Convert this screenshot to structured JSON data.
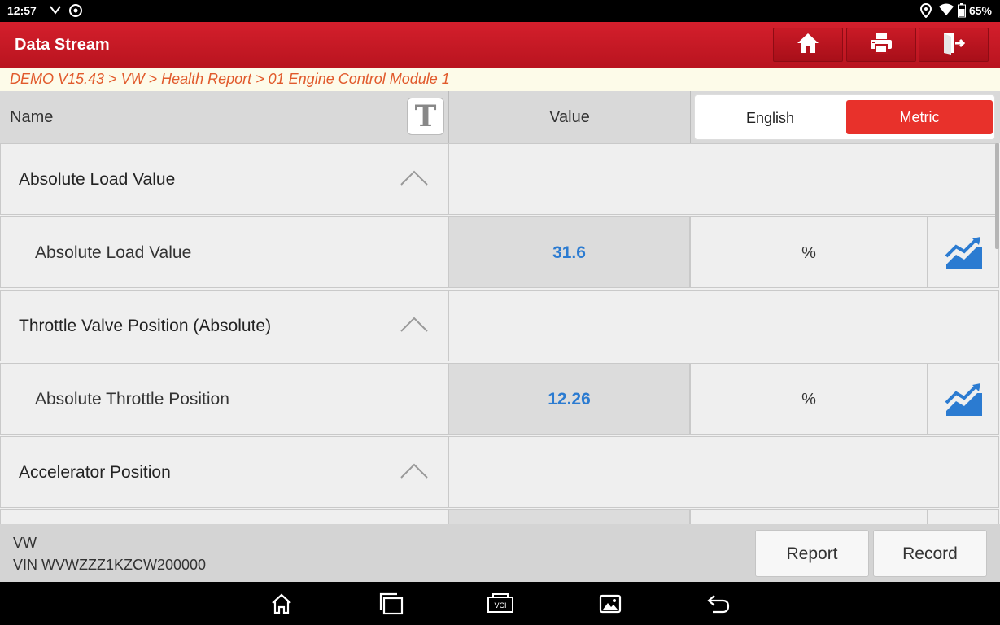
{
  "status_bar": {
    "time": "12:57",
    "battery": "65%"
  },
  "header": {
    "title": "Data Stream",
    "icons": [
      "home-icon",
      "print-icon",
      "exit-icon"
    ]
  },
  "breadcrumb": "DEMO V15.43 > VW > Health Report > 01 Engine Control Module 1",
  "table_header": {
    "name": "Name",
    "font_button": "T",
    "value": "Value",
    "unit_options": [
      "English",
      "Metric"
    ],
    "selected_unit": "Metric"
  },
  "rows": [
    {
      "group": "Absolute Load Value"
    },
    {
      "name": "Absolute Load Value",
      "value": "31.6",
      "unit": "%"
    },
    {
      "group": "Throttle Valve Position (Absolute)"
    },
    {
      "name": "Absolute Throttle Position",
      "value": "12.26",
      "unit": "%"
    },
    {
      "group": "Accelerator Position"
    }
  ],
  "footer": {
    "make": "VW",
    "vin": "VIN WVWZZZ1KZCW200000",
    "report_label": "Report",
    "record_label": "Record"
  },
  "navbar": {
    "icons": [
      "nav-home-icon",
      "nav-recents-icon",
      "vci-icon",
      "gallery-icon",
      "back-icon"
    ],
    "vci_label": "VCI"
  },
  "colors": {
    "header_red": "#c91a26",
    "value_blue": "#2b7bd1",
    "breadcrumb_orange": "#e15a2c",
    "metric_red": "#e8312b"
  }
}
